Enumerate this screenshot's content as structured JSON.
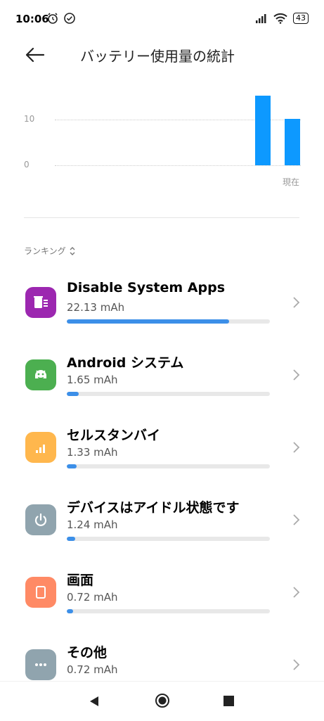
{
  "status_bar": {
    "time": "10:06",
    "battery": "43"
  },
  "header": {
    "title": "バッテリー使用量の統計"
  },
  "chart_data": {
    "type": "bar",
    "y_ticks": [
      "10",
      "0"
    ],
    "x_label_end": "現在",
    "values": [
      15.2,
      10.2
    ],
    "ylim": [
      0,
      10
    ],
    "color": "#0d99ff"
  },
  "ranking": {
    "label": "ランキング"
  },
  "items": [
    {
      "name": "Disable System Apps",
      "value": "22.13 mAh",
      "progress": 0.8,
      "icon": "trash-list-icon",
      "color": "#9c27b0"
    },
    {
      "name": "Android システム",
      "value": "1.65 mAh",
      "progress": 0.06,
      "icon": "android-icon",
      "color": "#4caf50"
    },
    {
      "name": "セルスタンバイ",
      "value": "1.33 mAh",
      "progress": 0.05,
      "icon": "signal-icon",
      "color": "#ffb74d"
    },
    {
      "name": "デバイスはアイドル状態です",
      "value": "1.24 mAh",
      "progress": 0.04,
      "icon": "power-icon",
      "color": "#90a4ae"
    },
    {
      "name": "画面",
      "value": "0.72 mAh",
      "progress": 0.03,
      "icon": "screen-icon",
      "color": "#ff8a65"
    },
    {
      "name": "その他",
      "value": "0.72 mAh",
      "progress": 0.03,
      "icon": "more-icon",
      "color": "#90a4ae"
    }
  ]
}
